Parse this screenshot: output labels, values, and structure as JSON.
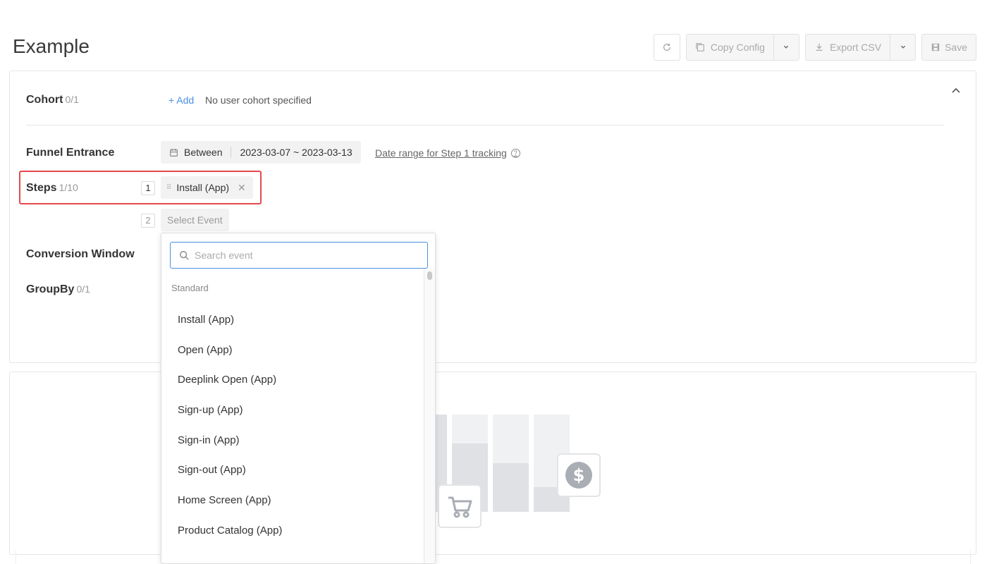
{
  "page": {
    "title": "Example"
  },
  "toolbar": {
    "copy_config_label": "Copy Config",
    "export_csv_label": "Export CSV",
    "save_label": "Save"
  },
  "cohort": {
    "label": "Cohort",
    "count": "0/1",
    "add_label": "+ Add",
    "empty_text": "No user cohort specified"
  },
  "funnel_entrance": {
    "label": "Funnel Entrance",
    "mode": "Between",
    "date_range": "2023-03-07 ~ 2023-03-13",
    "hint": "Date range for Step 1 tracking",
    "help_glyph": "?"
  },
  "steps": {
    "label": "Steps",
    "count": "1/10",
    "items": [
      {
        "number": "1",
        "event": "Install (App)"
      }
    ],
    "next_number": "2",
    "next_placeholder": "Select Event"
  },
  "conversion_window": {
    "label": "Conversion Window"
  },
  "group_by": {
    "label": "GroupBy",
    "count": "0/1"
  },
  "event_dropdown": {
    "search_placeholder": "Search event",
    "group": "Standard",
    "events": [
      "Install (App)",
      "Open (App)",
      "Deeplink Open (App)",
      "Sign-up (App)",
      "Sign-in (App)",
      "Sign-out (App)",
      "Home Screen (App)",
      "Product Catalog (App)"
    ]
  },
  "illustration": {
    "funnel_levels": [
      1.0,
      0.7,
      0.5,
      0.25
    ],
    "icons": [
      "shopping-cart-icon",
      "dollar-coin-icon"
    ]
  },
  "colors": {
    "accent": "#4a90e2",
    "highlight": "#e5484d"
  }
}
